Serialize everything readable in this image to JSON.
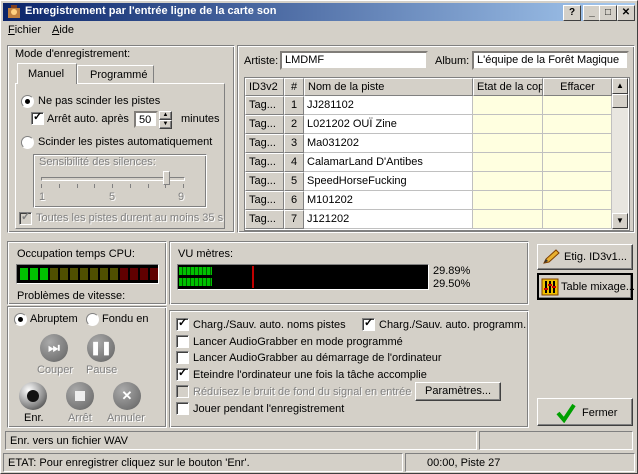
{
  "window": {
    "title": "Enregistrement par l'entrée ligne de la carte son"
  },
  "titlebar_buttons": {
    "help": "?",
    "minimize": "_",
    "maximize": "□",
    "close": "✕"
  },
  "menu": {
    "items": [
      {
        "label": "Fichier",
        "accel": "F"
      },
      {
        "label": "Aide",
        "accel": "A"
      }
    ]
  },
  "mode": {
    "group_label": "Mode d'enregistrement:",
    "tabs": [
      "Manuel",
      "Programmé"
    ],
    "active_tab": "Manuel",
    "no_split_label": "Ne pas scinder les pistes",
    "auto_stop_label": "Arrêt auto. après",
    "auto_stop_value": "50",
    "minutes_label": "minutes",
    "auto_split_label": "Scinder les pistes automatiquement",
    "silence_label": "Sensibilité des silences:",
    "slider_ticks": [
      "1",
      "5",
      "9"
    ],
    "slider_value": 8,
    "all_tracks_label": "Toutes les pistes durent au moins 35 s"
  },
  "meta": {
    "artist_label": "Artiste:",
    "artist_value": "LMDMF",
    "album_label": "Album:",
    "album_value": "L'équipe de la Forêt Magique"
  },
  "tracks": {
    "headers": [
      "ID3v2",
      "#",
      "Nom de la piste",
      "Etat de la copi",
      "Effacer"
    ],
    "tag_label": "Tag...",
    "rows": [
      {
        "num": "1",
        "name": "JJ281102"
      },
      {
        "num": "2",
        "name": "L021202 OUÏ Zine"
      },
      {
        "num": "3",
        "name": "Ma031202"
      },
      {
        "num": "4",
        "name": "CalamarLand D'Antibes"
      },
      {
        "num": "5",
        "name": "SpeedHorseFucking"
      },
      {
        "num": "6",
        "name": "M101202"
      },
      {
        "num": "7",
        "name": "J121202"
      }
    ]
  },
  "cpu": {
    "label": "Occupation temps CPU:",
    "speed_label": "Problèmes de vitesse:",
    "segments_lit": 3,
    "segments_total": 14
  },
  "vu": {
    "label": "VU mètres:",
    "left_value": "29.89%",
    "right_value": "29.50%",
    "left_level": 0.2989,
    "right_level": 0.295
  },
  "side_buttons": {
    "id3v1": "Etig. ID3v1...",
    "mixer": "Table mixage..."
  },
  "transport": {
    "abrupt_label": "Abruptem",
    "fade_label": "Fondu en",
    "cut_label": "Couper",
    "pause_label": "Pause",
    "rec_label": "Enr.",
    "stop_label": "Arrêt",
    "cancel_label": "Annuler"
  },
  "options": {
    "auto_names": "Charg./Sauv. auto. noms pistes",
    "auto_prog": "Charg./Sauv. auto. programm.",
    "launch_prog": "Lancer AudioGrabber en mode programmé",
    "launch_boot": "Lancer AudioGrabber au démarrage de l'ordinateur",
    "shutdown": "Eteindre l'ordinateur une fois la tâche accomplie",
    "noise": "Réduisez le bruit de fond du signal en entrée",
    "params_button": "Paramètres...",
    "play_while": "Jouer pendant l'enregistrement"
  },
  "close_button": "Fermer",
  "status": {
    "file_type": "Enr. vers un fichier WAV",
    "state": "ETAT: Pour enregistrer cliquez sur le bouton 'Enr'.",
    "time": "00:00, Piste 27"
  },
  "colors": {
    "title_start": "#0a246a",
    "title_end": "#a6caf0",
    "vu_green": "#00c000",
    "vu_red": "#c00000",
    "grid_yellow": "#ffffe0"
  }
}
